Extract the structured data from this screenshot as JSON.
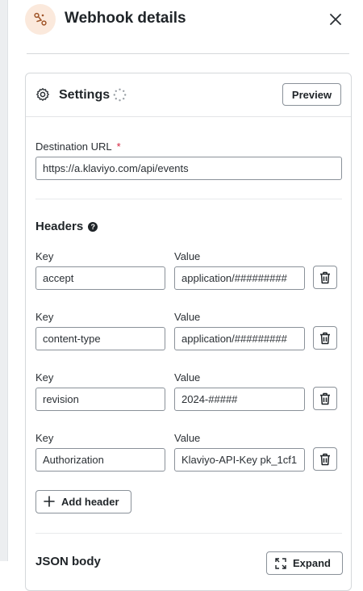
{
  "header": {
    "title": "Webhook details",
    "icon": "webhook-icon",
    "accent": "#fbe9dc"
  },
  "settings": {
    "title": "Settings",
    "preview_label": "Preview",
    "destination_url_label": "Destination URL",
    "required_marker": "*",
    "destination_url_value": "https://a.klaviyo.com/api/events"
  },
  "headers_section": {
    "title": "Headers",
    "help_icon": "?",
    "key_label": "Key",
    "value_label": "Value",
    "rows": [
      {
        "key": "accept",
        "value": "application/#########"
      },
      {
        "key": "content-type",
        "value": "application/#########"
      },
      {
        "key": "revision",
        "value": "2024-#####"
      },
      {
        "key": "Authorization",
        "value": "Klaviyo-API-Key pk_1cf1"
      }
    ],
    "add_label": "Add header"
  },
  "json_body": {
    "label": "JSON body",
    "expand_label": "Expand"
  },
  "colors": {
    "required": "#d5213d",
    "border": "#8a9199",
    "text": "#1f2428"
  }
}
